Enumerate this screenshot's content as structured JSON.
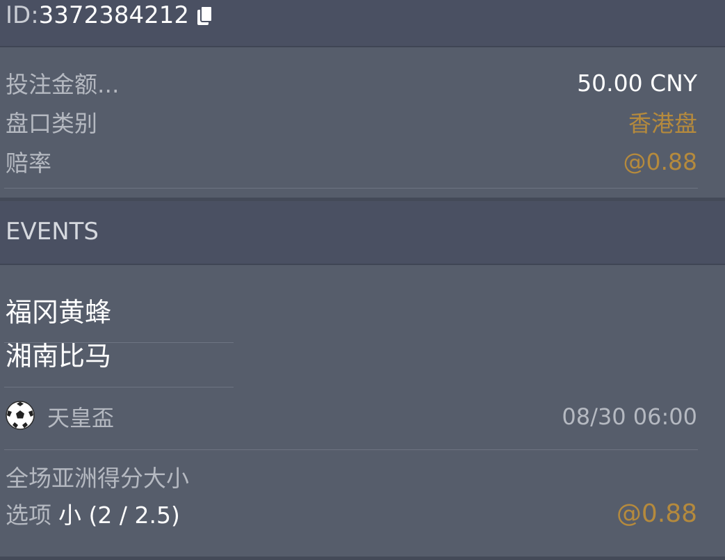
{
  "bet": {
    "id_prefix": "ID:",
    "id_number": "3372384212",
    "copy_icon": "copy-icon",
    "fields": [
      {
        "label": "投注金额...",
        "value": "50.00 CNY"
      },
      {
        "label": "盘口类别",
        "value": "香港盘"
      },
      {
        "label": "赔率",
        "value": "@0.88"
      }
    ]
  },
  "events": {
    "header": "EVENTS",
    "home_team": "福冈黄蜂",
    "away_team": "湘南比马",
    "sport_icon": "soccer-ball-icon",
    "league": "天皇盃",
    "datetime": "08/30 06:00",
    "market": "全场亚洲得分大小",
    "option_label": "选项",
    "option_value": "小 (2 / 2.5)",
    "option_odds": "@0.88"
  },
  "colors": {
    "background": "#565d6b",
    "header": "#4a5062",
    "gold": "#b58a3d",
    "muted_text": "#b5b9c1"
  }
}
